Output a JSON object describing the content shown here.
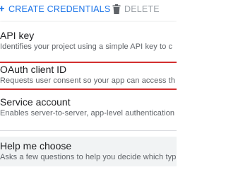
{
  "toolbar": {
    "create_label": "CREATE CREDENTIALS",
    "delete_label": "DELETE",
    "create_icon": "plus-icon",
    "delete_icon": "trash-icon"
  },
  "menu": {
    "items": [
      {
        "title": "API key",
        "description": "Identifies your project using a simple API key to c"
      },
      {
        "title": "OAuth client ID",
        "description": "Requests user consent so your app can access th"
      },
      {
        "title": "Service account",
        "description": "Enables server-to-server, app-level authentication"
      },
      {
        "title": "Help me choose",
        "description": "Asks a few questions to help you decide which typ"
      }
    ]
  },
  "colors": {
    "accent": "#1a73e8",
    "disabled": "#9aa0a6",
    "highlight_border": "#d32f2f",
    "hover_bg": "#f1f3f4"
  }
}
